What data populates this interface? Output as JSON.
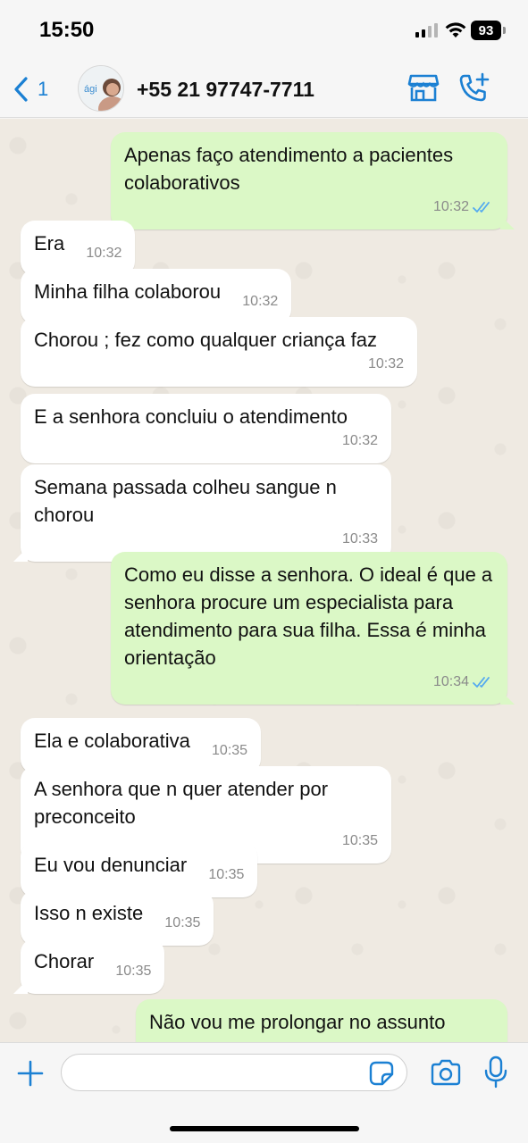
{
  "status_bar": {
    "time": "15:50",
    "battery": "93"
  },
  "header": {
    "back_count": "1",
    "avatar_text": "ági",
    "contact_name": "+55 21 97747-7711"
  },
  "messages": [
    {
      "text": "Apenas faço atendimento a pacientes colaborativos",
      "time": "10:32"
    },
    {
      "text": "Era",
      "time": "10:32"
    },
    {
      "text": "Minha filha colaborou",
      "time": "10:32"
    },
    {
      "text": "Chorou ; fez como qualquer criança faz",
      "time": "10:32"
    },
    {
      "text": "E a senhora concluiu o atendimento",
      "time": "10:32"
    },
    {
      "text": "Semana passada colheu sangue n chorou",
      "time": "10:33"
    },
    {
      "text": "Como eu disse a senhora. O ideal é que a senhora procure um especialista para atendimento para sua filha. Essa é minha orientação",
      "time": "10:34"
    },
    {
      "text": "Ela e colaborativa",
      "time": "10:35"
    },
    {
      "text": "A senhora que n quer atender por preconceito",
      "time": "10:35"
    },
    {
      "text": "Eu vou denunciar",
      "time": "10:35"
    },
    {
      "text": "Isso n existe",
      "time": "10:35"
    },
    {
      "text": "Chorar",
      "time": "10:35"
    },
    {
      "text": "Não vou me prolongar no assunto",
      "time": ""
    }
  ],
  "input": {
    "value": "",
    "placeholder": ""
  },
  "colors": {
    "accent": "#1b80d3",
    "outgoing_bubble": "#dbf8c6",
    "incoming_bubble": "#ffffff",
    "chat_bg": "#efeae2",
    "read_ticks": "#53a9f0"
  },
  "icons": [
    "back-chevron-icon",
    "store-icon",
    "call-add-icon",
    "plus-icon",
    "sticker-icon",
    "camera-icon",
    "microphone-icon",
    "read-receipt-icon"
  ]
}
